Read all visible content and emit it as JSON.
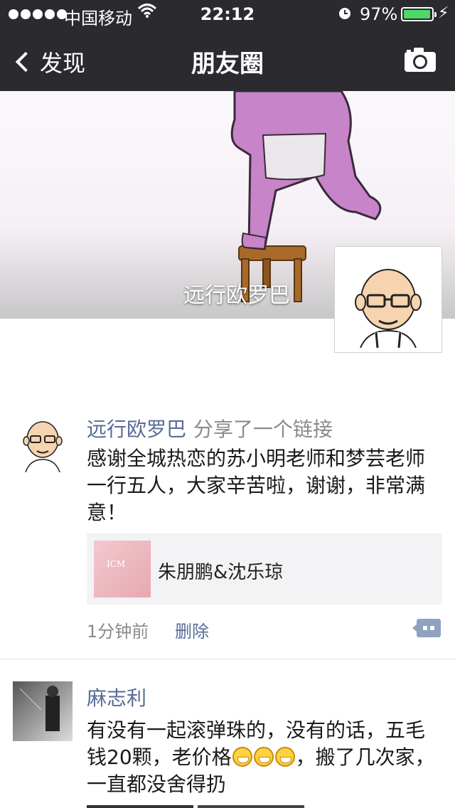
{
  "status_bar": {
    "carrier": "中国移动",
    "time": "22:12",
    "battery_percent_label": "97%",
    "battery_level": 0.97,
    "icons": [
      "signal-dots-icon",
      "wifi-icon",
      "alarm-icon",
      "battery-icon",
      "charging-bolt-icon"
    ]
  },
  "nav": {
    "back_label": "发现",
    "title": "朋友圈",
    "right_icon": "camera-icon"
  },
  "cover": {
    "owner_name": "远行欧罗巴"
  },
  "posts": [
    {
      "nickname": "远行欧罗巴",
      "action": "分享了一个链接",
      "text": "感谢全城热恋的苏小明老师和梦芸老师一行五人，大家辛苦啦，谢谢，非常满意！",
      "link": {
        "title": "朱朋鹏&沈乐琼",
        "thumb_text": "ICM"
      },
      "time": "1分钟前",
      "delete_label": "删除"
    },
    {
      "nickname": "麻志利",
      "text_before": "有没有一起滚弹珠的，没有的话，五毛钱20颗，老价格",
      "emoji_count": 3,
      "text_after": "，搬了几次家，一直都没舍得扔"
    }
  ],
  "colors": {
    "nav_bg": "#2b2a2f",
    "nickname": "#576b95",
    "battery": "#4cd964",
    "link_card_bg": "#f3f3f5"
  }
}
